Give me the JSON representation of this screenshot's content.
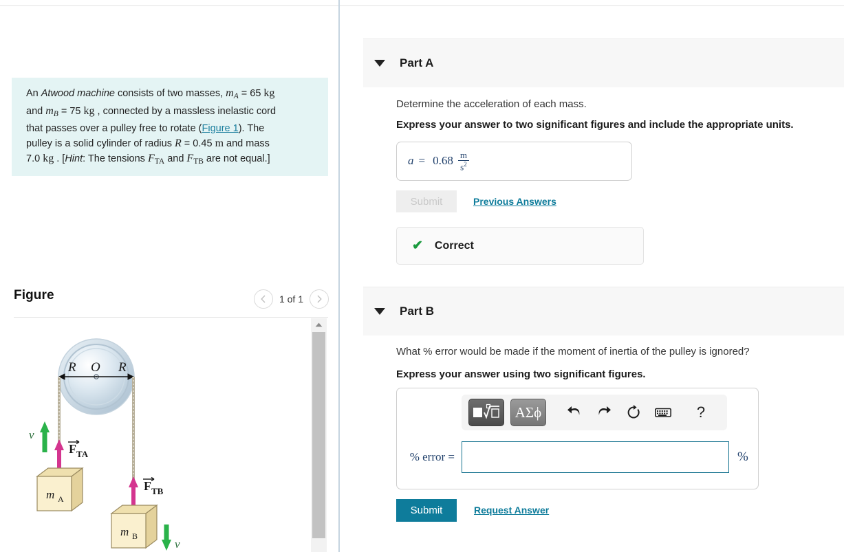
{
  "problem": {
    "intro_1": "An ",
    "emph_1": "Atwood machine",
    "intro_2": " consists of two masses, ",
    "mA_sym": "m",
    "mA_sub": "A",
    "mA_eq": " = 65 ",
    "mA_unit": "kg",
    "line2_1": "and ",
    "mB_sym": "m",
    "mB_sub": "B",
    "mB_eq": " = 75 ",
    "mB_unit": "kg",
    "line2_2": " , connected by a massless inelastic cord",
    "line3_1": "that passes over a pulley free to rotate (",
    "figure_link": "Figure 1",
    "line3_2": "). The",
    "line4_1": "pulley is a solid cylinder of radius ",
    "R_sym": "R",
    "R_eq": " = 0.45 ",
    "R_unit": "m",
    "line4_2": " and mass",
    "line5_1": "7.0 ",
    "mass_unit": "kg",
    "line5_2": " . [",
    "hint_word": "Hint",
    "line5_3": ": The tensions ",
    "FTA_sym": "F",
    "FTA_sub": "TA",
    "line5_4": " and ",
    "FTB_sym": "F",
    "FTB_sub": "TB",
    "line5_5": " are not equal.]",
    "background_color": "#e4f4f4"
  },
  "figure_panel": {
    "title": "Figure",
    "counter": "1 of 1",
    "prev_icon": "chevron-left-icon",
    "next_icon": "chevron-right-icon",
    "diagram": {
      "pulley_labels": {
        "left_R": "R",
        "center_O": "O",
        "right_R": "R"
      },
      "mass_a_label": "m",
      "mass_a_sub": "A",
      "mass_b_label": "m",
      "mass_b_sub": "B",
      "tension_a_label": "F",
      "tension_a_sub": "TA",
      "tension_b_label": "F",
      "tension_b_sub": "TB",
      "velocity_label": "v",
      "colors": {
        "block_fill": "#f7e9c0",
        "block_stroke": "#9a8a60",
        "tension_arrow": "#d4358f",
        "velocity_arrow": "#2ab24a",
        "pulley_rim": "#b9c9d6"
      }
    }
  },
  "parts": [
    {
      "id": "part-a",
      "label": "Part A",
      "caret_icon": "caret-down-icon",
      "question": "Determine the acceleration of each mass.",
      "instruction": "Express your answer to two significant figures and include the appropriate units.",
      "answer": {
        "variable": "a",
        "equals": "=",
        "value": "0.68",
        "unit_numerator": "m",
        "unit_denominator": "s",
        "unit_exponent": "2"
      },
      "submit_label": "Submit",
      "submit_disabled": true,
      "previous_answers_label": "Previous Answers",
      "feedback": {
        "icon": "checkmark-icon",
        "text": "Correct",
        "color": "#1a9a3e"
      }
    },
    {
      "id": "part-b",
      "label": "Part B",
      "caret_icon": "caret-down-icon",
      "question": "What % error would be made if the moment of inertia of the pulley is ignored?",
      "instruction": "Express your answer using two significant figures.",
      "toolbar": {
        "template_key_label": "√",
        "greek_key_label": "ΑΣϕ",
        "undo_icon": "undo-arrow-icon",
        "redo_icon": "redo-arrow-icon",
        "reset_icon": "reset-circular-arrow-icon",
        "keyboard_icon": "keyboard-icon",
        "help_icon": "question-mark-icon",
        "help_label": "?"
      },
      "input": {
        "label": "% error =",
        "value": "",
        "placeholder": "",
        "suffix": "%",
        "border_color": "#13718e"
      },
      "submit_label": "Submit",
      "submit_disabled": false,
      "request_answer_label": "Request Answer"
    }
  ],
  "theme": {
    "link_color": "#0e7c9b",
    "submit_bg": "#0e7c9b",
    "header_bg": "#f7f7f7",
    "divider_color": "#c5d4e0",
    "math_text_color": "#20406b"
  }
}
